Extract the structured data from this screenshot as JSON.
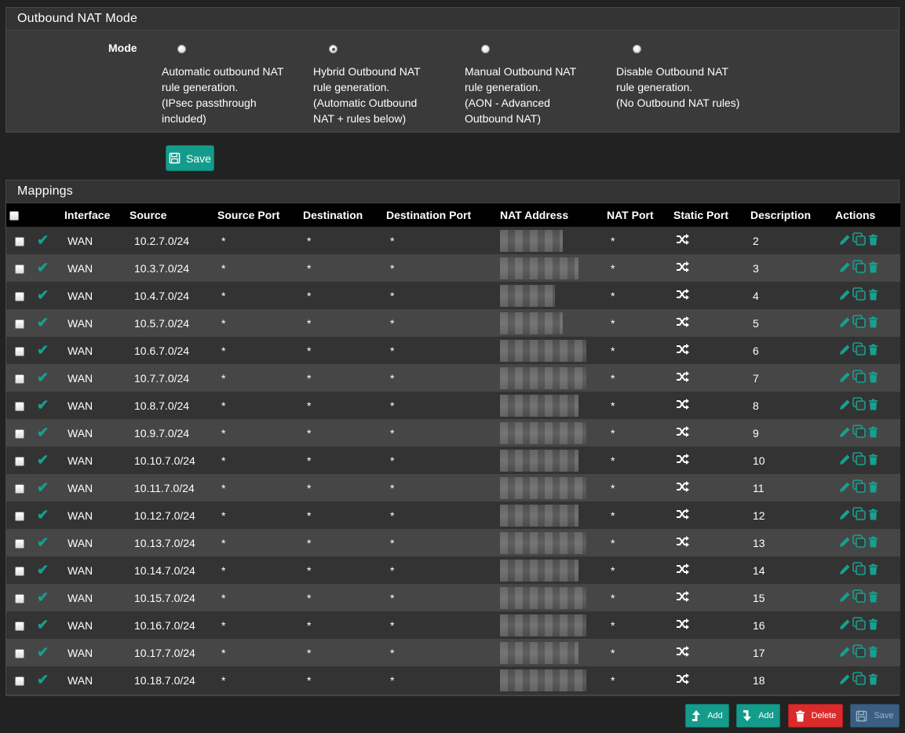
{
  "mode_panel": {
    "title": "Outbound NAT Mode",
    "mode_label": "Mode",
    "options": [
      {
        "text": "Automatic outbound NAT\nrule generation.\n(IPsec passthrough\nincluded)",
        "checked": false
      },
      {
        "text": "Hybrid Outbound NAT\nrule generation.\n(Automatic Outbound\nNAT + rules below)",
        "checked": true
      },
      {
        "text": "Manual Outbound NAT\nrule generation.\n(AON - Advanced\nOutbound NAT)",
        "checked": false
      },
      {
        "text": "Disable Outbound NAT\nrule generation.\n(No Outbound NAT rules)",
        "checked": false
      }
    ],
    "save_label": "Save"
  },
  "mappings": {
    "title": "Mappings",
    "columns": [
      "Interface",
      "Source",
      "Source Port",
      "Destination",
      "Destination Port",
      "NAT Address",
      "NAT Port",
      "Static Port",
      "Description",
      "Actions"
    ],
    "rows": [
      {
        "interface": "WAN",
        "source": "10.2.7.0/24",
        "source_port": "*",
        "destination": "*",
        "destination_port": "*",
        "nat_port": "*",
        "description": "2"
      },
      {
        "interface": "WAN",
        "source": "10.3.7.0/24",
        "source_port": "*",
        "destination": "*",
        "destination_port": "*",
        "nat_port": "*",
        "description": "3"
      },
      {
        "interface": "WAN",
        "source": "10.4.7.0/24",
        "source_port": "*",
        "destination": "*",
        "destination_port": "*",
        "nat_port": "*",
        "description": "4"
      },
      {
        "interface": "WAN",
        "source": "10.5.7.0/24",
        "source_port": "*",
        "destination": "*",
        "destination_port": "*",
        "nat_port": "*",
        "description": "5"
      },
      {
        "interface": "WAN",
        "source": "10.6.7.0/24",
        "source_port": "*",
        "destination": "*",
        "destination_port": "*",
        "nat_port": "*",
        "description": "6"
      },
      {
        "interface": "WAN",
        "source": "10.7.7.0/24",
        "source_port": "*",
        "destination": "*",
        "destination_port": "*",
        "nat_port": "*",
        "description": "7"
      },
      {
        "interface": "WAN",
        "source": "10.8.7.0/24",
        "source_port": "*",
        "destination": "*",
        "destination_port": "*",
        "nat_port": "*",
        "description": "8"
      },
      {
        "interface": "WAN",
        "source": "10.9.7.0/24",
        "source_port": "*",
        "destination": "*",
        "destination_port": "*",
        "nat_port": "*",
        "description": "9"
      },
      {
        "interface": "WAN",
        "source": "10.10.7.0/24",
        "source_port": "*",
        "destination": "*",
        "destination_port": "*",
        "nat_port": "*",
        "description": "10"
      },
      {
        "interface": "WAN",
        "source": "10.11.7.0/24",
        "source_port": "*",
        "destination": "*",
        "destination_port": "*",
        "nat_port": "*",
        "description": "11"
      },
      {
        "interface": "WAN",
        "source": "10.12.7.0/24",
        "source_port": "*",
        "destination": "*",
        "destination_port": "*",
        "nat_port": "*",
        "description": "12"
      },
      {
        "interface": "WAN",
        "source": "10.13.7.0/24",
        "source_port": "*",
        "destination": "*",
        "destination_port": "*",
        "nat_port": "*",
        "description": "13"
      },
      {
        "interface": "WAN",
        "source": "10.14.7.0/24",
        "source_port": "*",
        "destination": "*",
        "destination_port": "*",
        "nat_port": "*",
        "description": "14"
      },
      {
        "interface": "WAN",
        "source": "10.15.7.0/24",
        "source_port": "*",
        "destination": "*",
        "destination_port": "*",
        "nat_port": "*",
        "description": "15"
      },
      {
        "interface": "WAN",
        "source": "10.16.7.0/24",
        "source_port": "*",
        "destination": "*",
        "destination_port": "*",
        "nat_port": "*",
        "description": "16"
      },
      {
        "interface": "WAN",
        "source": "10.17.7.0/24",
        "source_port": "*",
        "destination": "*",
        "destination_port": "*",
        "nat_port": "*",
        "description": "17"
      },
      {
        "interface": "WAN",
        "source": "10.18.7.0/24",
        "source_port": "*",
        "destination": "*",
        "destination_port": "*",
        "nat_port": "*",
        "description": "18"
      }
    ]
  },
  "bottom_buttons": {
    "add_top": "Add",
    "add_bottom": "Add",
    "delete": "Delete",
    "save": "Save"
  },
  "icons": {
    "enabled": "check-icon",
    "static_port": "shuffle-icon",
    "edit": "pencil-icon",
    "copy": "copy-icon",
    "delete": "trash-icon"
  },
  "colors": {
    "accent": "#149b8b",
    "danger": "#d92b2b",
    "save_disabled": "#3a5e82",
    "page_bg": "#222222"
  }
}
